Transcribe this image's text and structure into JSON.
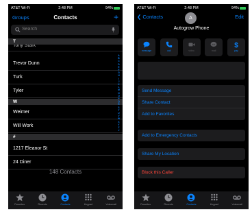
{
  "colors": {
    "accent": "#0a84ff",
    "danger": "#ff453a",
    "background": "#000000",
    "battery": "#34c759"
  },
  "status_bar": {
    "carrier": "AT&T Wi-Fi",
    "time": "2:48 PM",
    "battery": "94%"
  },
  "left": {
    "nav": {
      "groups_label": "Groups",
      "title": "Contacts",
      "add_icon": "plus-icon"
    },
    "search": {
      "placeholder": "Search"
    },
    "sections": [
      {
        "header": "T",
        "rows": [
          "Trevor Dunn",
          "Turk",
          "Tyler"
        ]
      },
      {
        "header": "W",
        "rows": [
          "Weimer",
          "Will Work"
        ]
      },
      {
        "header": "#",
        "rows": [
          "1217 Eleanor St",
          "24 Diner"
        ]
      }
    ],
    "cut_row": "Tony Stark",
    "count": "148 Contacts",
    "index_letters": [
      "A",
      "B",
      "C",
      "D",
      "E",
      "F",
      "G",
      "H",
      "I",
      "J",
      "K",
      "L",
      "M",
      "N",
      "O",
      "P",
      "Q",
      "R",
      "S",
      "T",
      "U",
      "V",
      "W",
      "X",
      "Y",
      "Z",
      "#"
    ]
  },
  "tabs": [
    {
      "label": "Favorites",
      "icon": "star-icon"
    },
    {
      "label": "Recents",
      "icon": "clock-icon"
    },
    {
      "label": "Contacts",
      "icon": "person-circle-icon",
      "active": true
    },
    {
      "label": "Keypad",
      "icon": "keypad-icon"
    },
    {
      "label": "Voicemail",
      "icon": "voicemail-icon"
    }
  ],
  "right": {
    "back_label": "Contacts",
    "edit_label": "Edit",
    "avatar_initial": "A",
    "name": "Autogrow Phone",
    "actions": [
      {
        "label": "message",
        "icon": "message-icon",
        "enabled": true
      },
      {
        "label": "call",
        "icon": "phone-icon",
        "enabled": true
      },
      {
        "label": "video",
        "icon": "video-icon",
        "enabled": false
      },
      {
        "label": "mail",
        "icon": "mail-icon",
        "enabled": false
      },
      {
        "label": "pay",
        "icon": "dollar-icon",
        "enabled": true
      }
    ],
    "group1": [
      "Send Message",
      "Share Contact",
      "Add to Favorites"
    ],
    "emergency": "Add to Emergency Contacts",
    "share_location": "Share My Location",
    "block": "Block this Caller"
  }
}
